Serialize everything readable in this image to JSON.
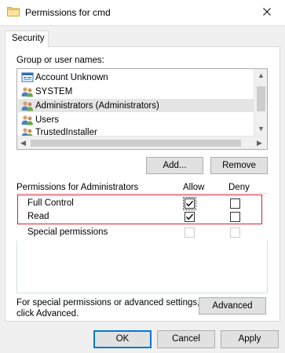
{
  "window": {
    "title": "Permissions for cmd",
    "close_icon": "close-icon",
    "title_icon": "folder-icon"
  },
  "tabs": [
    {
      "label": "Security",
      "selected": true
    }
  ],
  "group_section": {
    "label": "Group or user names:",
    "items": [
      {
        "label": "Account Unknown",
        "icon": "unknown-account-icon",
        "selected": false
      },
      {
        "label": "SYSTEM",
        "icon": "users-group-icon",
        "selected": false
      },
      {
        "label": "Administrators (Administrators)",
        "icon": "users-group-icon",
        "selected": true
      },
      {
        "label": "Users",
        "icon": "users-group-icon",
        "selected": false
      },
      {
        "label": "TrustedInstaller",
        "icon": "users-group-icon",
        "selected": false
      }
    ],
    "add_button": "Add...",
    "remove_button": "Remove"
  },
  "permissions": {
    "header": "Permissions for Administrators",
    "allow_header": "Allow",
    "deny_header": "Deny",
    "rows": [
      {
        "label": "Full Control",
        "allow": true,
        "deny": false,
        "enabled": true
      },
      {
        "label": "Read",
        "allow": true,
        "deny": false,
        "enabled": true
      },
      {
        "label": "Special permissions",
        "allow": false,
        "deny": false,
        "enabled": false
      }
    ]
  },
  "advanced": {
    "text_line1": "For special permissions or advanced settings,",
    "text_line2": "click Advanced.",
    "button": "Advanced"
  },
  "footer": {
    "ok": "OK",
    "cancel": "Cancel",
    "apply": "Apply"
  },
  "colors": {
    "highlight_box": "#e21d2f",
    "default_button_border": "#0078d7",
    "dialog_bg": "#f0f0f0"
  }
}
